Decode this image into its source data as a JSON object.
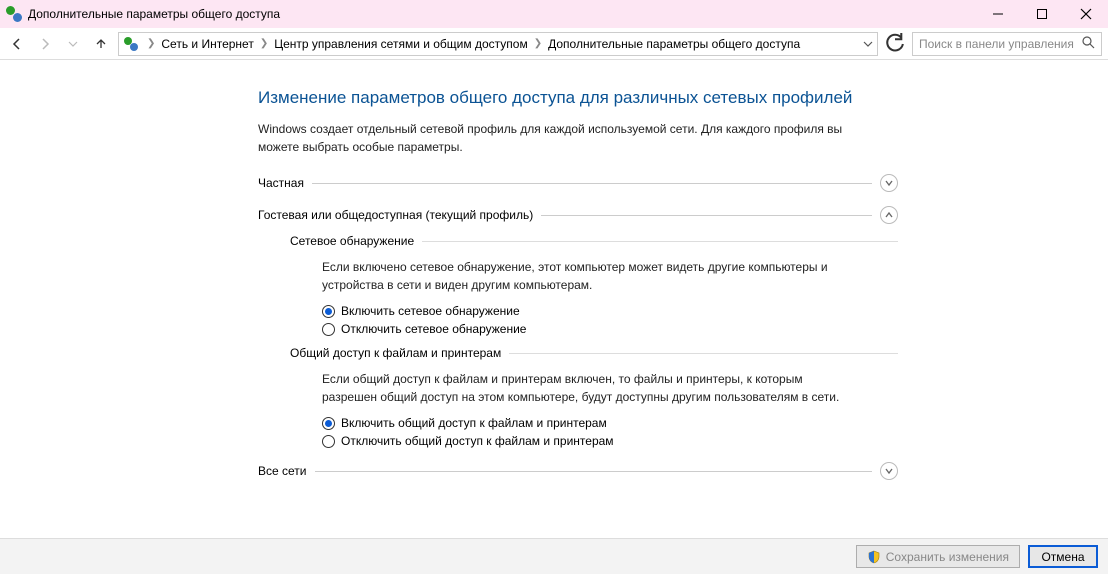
{
  "window": {
    "title": "Дополнительные параметры общего доступа"
  },
  "breadcrumb": {
    "item1": "Сеть и Интернет",
    "item2": "Центр управления сетями и общим доступом",
    "item3": "Дополнительные параметры общего доступа"
  },
  "search": {
    "placeholder": "Поиск в панели управления"
  },
  "page": {
    "title": "Изменение параметров общего доступа для различных сетевых профилей",
    "desc": "Windows создает отдельный сетевой профиль для каждой используемой сети. Для каждого профиля вы можете выбрать особые параметры."
  },
  "sections": {
    "private": {
      "title": "Частная"
    },
    "guest": {
      "title": "Гостевая или общедоступная (текущий профиль)",
      "discovery": {
        "title": "Сетевое обнаружение",
        "desc": "Если включено сетевое обнаружение, этот компьютер может видеть другие компьютеры и устройства в сети и виден другим компьютерам.",
        "on": "Включить сетевое обнаружение",
        "off": "Отключить сетевое обнаружение"
      },
      "sharing": {
        "title": "Общий доступ к файлам и принтерам",
        "desc": "Если общий доступ к файлам и принтерам включен, то файлы и принтеры, к которым разрешен общий доступ на этом компьютере, будут доступны другим пользователям в сети.",
        "on": "Включить общий доступ к файлам и принтерам",
        "off": "Отключить общий доступ к файлам и принтерам"
      }
    },
    "all": {
      "title": "Все сети"
    }
  },
  "footer": {
    "save": "Сохранить изменения",
    "cancel": "Отмена"
  }
}
